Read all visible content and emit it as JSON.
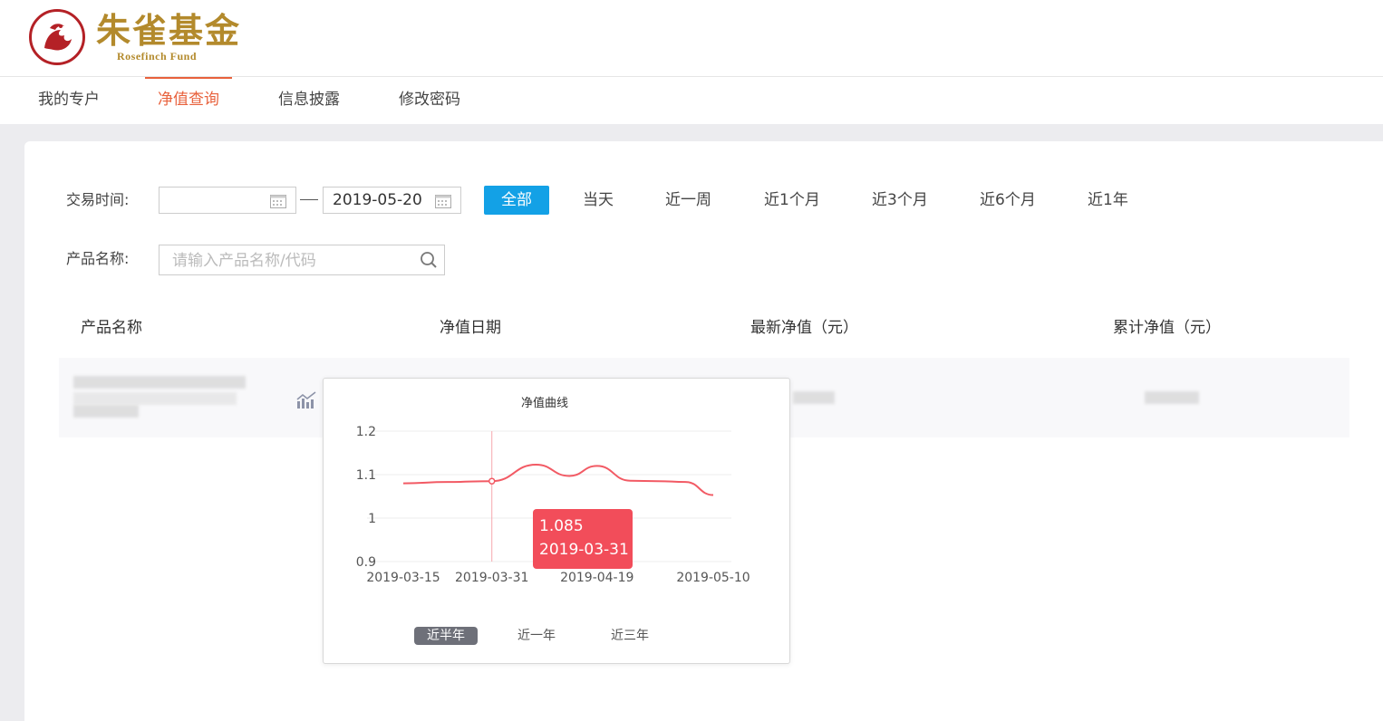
{
  "brand": {
    "name_cn": "朱雀基金",
    "name_en": "Rosefinch Fund"
  },
  "nav": {
    "items": [
      {
        "label": "我的专户"
      },
      {
        "label": "净值查询",
        "active": true
      },
      {
        "label": "信息披露"
      },
      {
        "label": "修改密码"
      }
    ]
  },
  "filters": {
    "trade_time_label": "交易时间:",
    "start_date": "",
    "end_date": "2019-05-20",
    "quick_ranges": [
      "全部",
      "当天",
      "近一周",
      "近1个月",
      "近3个月",
      "近6个月",
      "近1年"
    ],
    "active_range": "全部",
    "product_label": "产品名称:",
    "product_placeholder": "请输入产品名称/代码"
  },
  "table": {
    "headers": [
      "产品名称",
      "净值日期",
      "最新净值（元）",
      "累计净值（元）"
    ]
  },
  "colors": {
    "accent": "#e8613c",
    "primary_button": "#13a1e6",
    "line": "#f25a64",
    "tooltip": "#f24d5a"
  },
  "chart_popup": {
    "periods": [
      "近半年",
      "近一年",
      "近三年"
    ],
    "active_period": "近半年",
    "tooltip": {
      "value": "1.085",
      "date": "2019-03-31"
    }
  },
  "chart_data": {
    "type": "line",
    "title": "净值曲线",
    "xlabel": "",
    "ylabel": "",
    "ylim": [
      0.9,
      1.2
    ],
    "y_ticks": [
      "1.2",
      "1.1",
      "1",
      "0.9"
    ],
    "x_ticks": [
      "2019-03-15",
      "2019-03-31",
      "2019-04-19",
      "2019-05-10"
    ],
    "grid": true,
    "series": [
      {
        "x": [
          "2019-03-15",
          "2019-03-23",
          "2019-03-31",
          "2019-04-08",
          "2019-04-14",
          "2019-04-19",
          "2019-04-25",
          "2019-04-30",
          "2019-05-05",
          "2019-05-10"
        ],
        "values": [
          1.08,
          1.083,
          1.085,
          1.123,
          1.097,
          1.12,
          1.086,
          1.085,
          1.083,
          1.053
        ]
      }
    ],
    "highlight": {
      "x": "2019-03-31",
      "y": 1.085
    }
  }
}
